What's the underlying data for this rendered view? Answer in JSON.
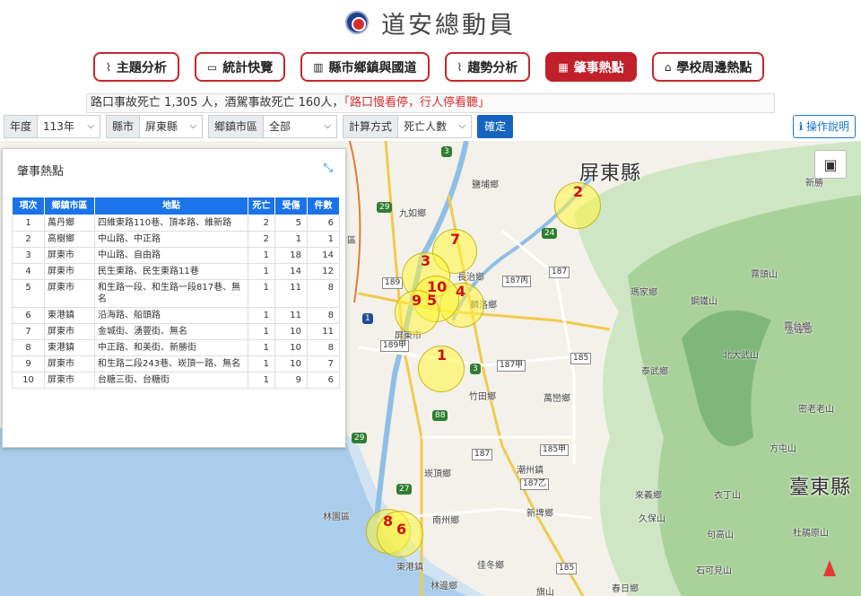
{
  "header": {
    "title": "道安總動員"
  },
  "nav": [
    {
      "label": "主題分析",
      "icon": "⌇",
      "active": false
    },
    {
      "label": "統計快覽",
      "icon": "▭",
      "active": false
    },
    {
      "label": "縣市鄉鎮與國道",
      "icon": "▥",
      "active": false
    },
    {
      "label": "趨勢分析",
      "icon": "⌇",
      "active": false
    },
    {
      "label": "肇事熱點",
      "icon": "▦",
      "active": true
    },
    {
      "label": "學校周邊熱點",
      "icon": "⌂",
      "active": false
    }
  ],
  "ticker": {
    "text": "路口事故死亡 1,305 人，酒駕事故死亡 160人，",
    "highlight": "「路口慢看停，行人停看聽」"
  },
  "filters": {
    "year_label": "年度",
    "year_value": "113年",
    "county_label": "縣市",
    "county_value": "屏東縣",
    "town_label": "鄉鎮市區",
    "town_value": "全部",
    "method_label": "計算方式",
    "method_value": "死亡人數",
    "confirm": "確定"
  },
  "help_label": "操作說明",
  "panel": {
    "title": "肇事熱點",
    "headers": [
      "項次",
      "鄉鎮市區",
      "地點",
      "死亡",
      "受傷",
      "件數"
    ],
    "rows": [
      [
        "1",
        "萬丹鄉",
        "四維東路110巷、頂本路、維新路",
        "2",
        "5",
        "6"
      ],
      [
        "2",
        "高樹鄉",
        "中山路、中正路",
        "2",
        "1",
        "1"
      ],
      [
        "3",
        "屏東市",
        "中山路、自由路",
        "1",
        "18",
        "14"
      ],
      [
        "4",
        "屏東市",
        "民生東路、民生東路11巷",
        "1",
        "14",
        "12"
      ],
      [
        "5",
        "屏東市",
        "和生路一段、和生路一段817巷、無名",
        "1",
        "11",
        "8"
      ],
      [
        "6",
        "東港鎮",
        "沿海路、船頭路",
        "1",
        "11",
        "8"
      ],
      [
        "7",
        "屏東市",
        "金城街、湧豐街、無名",
        "1",
        "10",
        "11"
      ],
      [
        "8",
        "東港鎮",
        "中正路、和美街、新勝街",
        "1",
        "10",
        "8"
      ],
      [
        "9",
        "屏東市",
        "和生路二段243巷、崁頂一路、無名",
        "1",
        "10",
        "7"
      ],
      [
        "10",
        "屏東市",
        "台糖三街、台糖街",
        "1",
        "9",
        "6"
      ]
    ]
  },
  "map": {
    "counties": [
      "屏東縣",
      "臺東縣"
    ],
    "places": [
      "鹽埔鄉",
      "九如鄉",
      "大樹區",
      "長治鄉",
      "麟洛鄉",
      "瑪家鄉",
      "泰武鄉",
      "屏東市",
      "竹田鄉",
      "萬巒鄉",
      "崁頂鄉",
      "潮州鎮",
      "南州鄉",
      "新埤鄉",
      "林園區",
      "東港鎮",
      "佳冬鄉",
      "林邊鄉",
      "來義鄉",
      "霧台鄉",
      "北大武山",
      "霧頭山",
      "鋼鐵山",
      "金峰鄉",
      "密老老山",
      "方屯山",
      "衣丁山",
      "久保山",
      "句高山",
      "石可見山",
      "杜鵑原山",
      "旗山",
      "春日鄉",
      "新勝"
    ],
    "hotspots": [
      "1",
      "2",
      "3",
      "4",
      "5",
      "6",
      "7",
      "8",
      "9",
      "10"
    ]
  }
}
